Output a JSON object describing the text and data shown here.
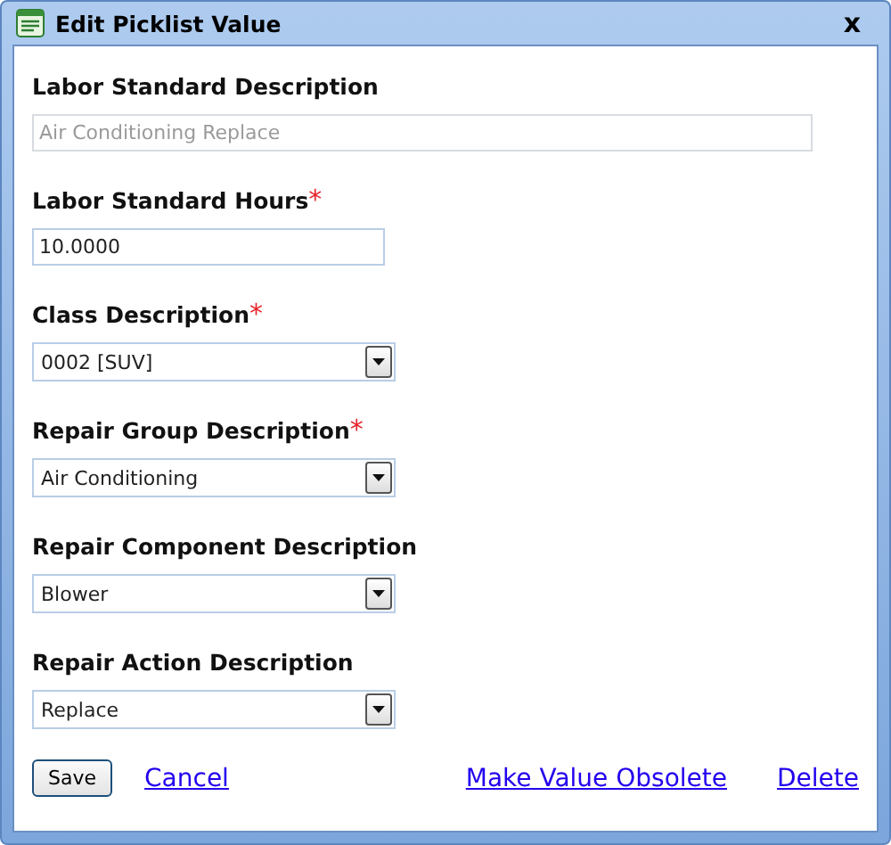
{
  "window": {
    "title": "Edit Picklist Value",
    "close": "x"
  },
  "fields": [
    {
      "label": "Labor Standard Description",
      "kind": "wide-text",
      "required": false,
      "disabled": true,
      "value": "Air Conditioning Replace"
    },
    {
      "label": "Labor Standard Hours",
      "kind": "text",
      "required": true,
      "disabled": false,
      "value": "10.0000"
    },
    {
      "label": "Class Description",
      "kind": "select",
      "required": true,
      "disabled": false,
      "value": "0002 [SUV]"
    },
    {
      "label": "Repair Group Description",
      "kind": "select",
      "required": true,
      "disabled": false,
      "value": "Air Conditioning"
    },
    {
      "label": "Repair Component Description",
      "kind": "select",
      "required": false,
      "disabled": false,
      "value": "Blower"
    },
    {
      "label": "Repair Action Description",
      "kind": "select",
      "required": false,
      "disabled": false,
      "value": "Replace"
    }
  ],
  "required_mark": "*",
  "actions": {
    "save": "Save",
    "cancel": "Cancel",
    "obsolete": "Make Value Obsolete",
    "delete": "Delete"
  }
}
